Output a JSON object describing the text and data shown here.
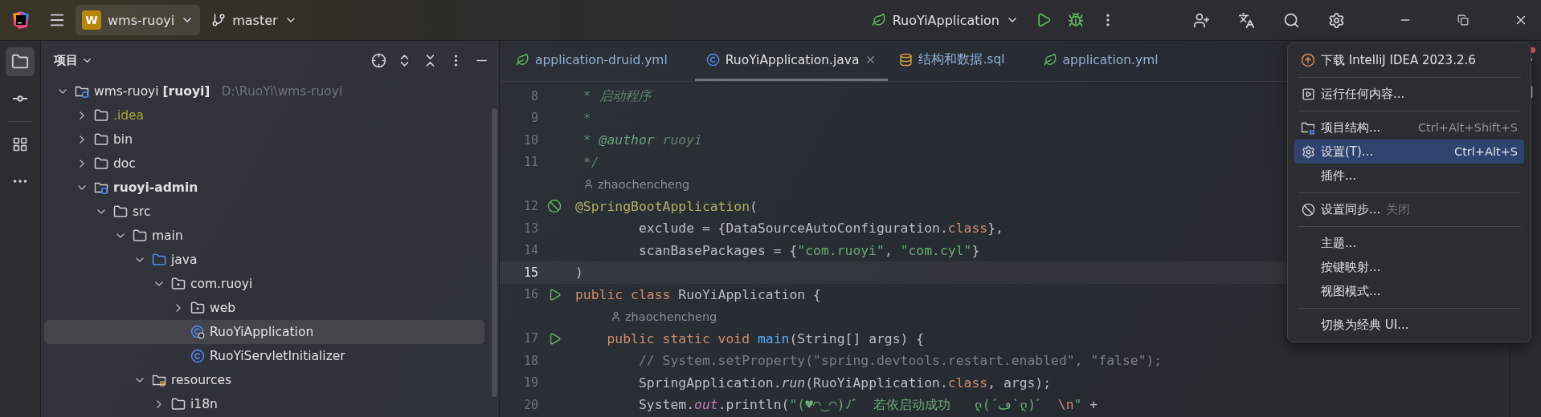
{
  "title_bar": {
    "project": {
      "badge": "W",
      "name": "wms-ruoyi"
    },
    "branch": "master",
    "run_config": "RuoYiApplication"
  },
  "project_panel": {
    "title": "项目",
    "tree": [
      {
        "label": "wms-ruoyi **[ruoyi]**",
        "hint": "D:\\RuoYi\\wms-ruoyi",
        "kind": "module",
        "expanded": true,
        "selected": false,
        "ignored": false,
        "bold": false,
        "children": [
          {
            "label": ".idea",
            "kind": "folder",
            "expanded": false,
            "selected": false,
            "ignored": true,
            "bold": false
          },
          {
            "label": "bin",
            "kind": "folder",
            "expanded": false,
            "selected": false,
            "ignored": false,
            "bold": false
          },
          {
            "label": "doc",
            "kind": "folder",
            "expanded": false,
            "selected": false,
            "ignored": false,
            "bold": false
          },
          {
            "label": "ruoyi-admin",
            "kind": "module",
            "expanded": true,
            "selected": false,
            "ignored": false,
            "bold": true,
            "children": [
              {
                "label": "src",
                "kind": "folder",
                "expanded": true,
                "selected": false,
                "ignored": false,
                "bold": false,
                "children": [
                  {
                    "label": "main",
                    "kind": "folder",
                    "expanded": true,
                    "selected": false,
                    "ignored": false,
                    "bold": false,
                    "children": [
                      {
                        "label": "java",
                        "kind": "source",
                        "expanded": true,
                        "selected": false,
                        "ignored": false,
                        "bold": false,
                        "children": [
                          {
                            "label": "com.ruoyi",
                            "kind": "package",
                            "expanded": true,
                            "selected": false,
                            "ignored": false,
                            "bold": false,
                            "children": [
                              {
                                "label": "web",
                                "kind": "package",
                                "expanded": false,
                                "selected": false,
                                "ignored": false,
                                "bold": false
                              },
                              {
                                "label": "RuoYiApplication",
                                "kind": "run-class",
                                "selected": true,
                                "ignored": false,
                                "bold": false
                              },
                              {
                                "label": "RuoYiServletInitializer",
                                "kind": "class",
                                "selected": false,
                                "ignored": false,
                                "bold": false
                              }
                            ]
                          }
                        ]
                      },
                      {
                        "label": "resources",
                        "kind": "resources",
                        "expanded": true,
                        "selected": false,
                        "ignored": false,
                        "bold": false,
                        "children": [
                          {
                            "label": "i18n",
                            "kind": "folder",
                            "expanded": false,
                            "selected": false,
                            "ignored": false,
                            "bold": false
                          }
                        ]
                      }
                    ]
                  }
                ]
              }
            ]
          }
        ]
      }
    ]
  },
  "editor_tabs": [
    {
      "label": "application-druid.yml",
      "kind": "spring",
      "selected": false
    },
    {
      "label": "RuoYiApplication.java",
      "kind": "java",
      "selected": true
    },
    {
      "label": "结构和数据.sql",
      "kind": "sql",
      "selected": false
    },
    {
      "label": "application.yml",
      "kind": "spring",
      "selected": false
    }
  ],
  "code": [
    {
      "kind": "line",
      "number": "8",
      "current": false,
      "tokens": [
        {
          "kind": "doc",
          "text": " * 启动程序"
        }
      ]
    },
    {
      "kind": "line",
      "number": "9",
      "current": false,
      "tokens": [
        {
          "kind": "doc",
          "text": " *"
        }
      ]
    },
    {
      "kind": "line",
      "number": "10",
      "current": false,
      "tokens": [
        {
          "kind": "doc",
          "text": " * "
        },
        {
          "kind": "doctag",
          "text": "@author"
        },
        {
          "kind": "doc",
          "text": " ruoyi"
        }
      ]
    },
    {
      "kind": "line",
      "number": "11",
      "current": false,
      "tokens": [
        {
          "kind": "doc",
          "text": " */"
        }
      ]
    },
    {
      "kind": "author",
      "text": "zhaochencheng"
    },
    {
      "kind": "bean-line",
      "number": "12",
      "current": false,
      "tokens": [
        {
          "kind": "annotation",
          "text": "@SpringBootApplication"
        },
        {
          "kind": "plain",
          "text": "("
        }
      ]
    },
    {
      "kind": "line",
      "number": "13",
      "current": false,
      "tokens": [
        {
          "kind": "plain",
          "text": "        exclude = {DataSourceAutoConfiguration."
        },
        {
          "kind": "keyword",
          "text": "class"
        },
        {
          "kind": "plain",
          "text": "},"
        }
      ]
    },
    {
      "kind": "line",
      "number": "14",
      "current": false,
      "tokens": [
        {
          "kind": "plain",
          "text": "        scanBasePackages = {"
        },
        {
          "kind": "string",
          "text": "\"com.ruoyi\""
        },
        {
          "kind": "plain",
          "text": ", "
        },
        {
          "kind": "string",
          "text": "\"com.cyl\""
        },
        {
          "kind": "plain",
          "text": "}"
        }
      ]
    },
    {
      "kind": "line",
      "number": "15",
      "current": true,
      "tokens": [
        {
          "kind": "plain",
          "text": ")"
        }
      ]
    },
    {
      "kind": "run-line",
      "number": "16",
      "current": false,
      "tokens": [
        {
          "kind": "keyword",
          "text": "public class "
        },
        {
          "kind": "plain",
          "text": "RuoYiApplication {"
        }
      ]
    },
    {
      "kind": "nested-author",
      "text": "zhaochencheng"
    },
    {
      "kind": "run-line",
      "number": "17",
      "current": false,
      "tokens": [
        {
          "kind": "keyword",
          "text": "    public static void "
        },
        {
          "kind": "method",
          "text": "main"
        },
        {
          "kind": "plain",
          "text": "(String[] args) {"
        }
      ]
    },
    {
      "kind": "line",
      "number": "18",
      "current": false,
      "tokens": [
        {
          "kind": "comment",
          "text": "        // System.setProperty(\"spring.devtools.restart.enabled\", \"false\");"
        }
      ]
    },
    {
      "kind": "line",
      "number": "19",
      "current": false,
      "tokens": [
        {
          "kind": "plain",
          "text": "        SpringApplication."
        },
        {
          "kind": "italic",
          "text": "run"
        },
        {
          "kind": "plain",
          "text": "(RuoYiApplication."
        },
        {
          "kind": "keyword",
          "text": "class"
        },
        {
          "kind": "plain",
          "text": ", args);"
        }
      ]
    },
    {
      "kind": "line",
      "number": "20",
      "current": false,
      "tokens": [
        {
          "kind": "plain",
          "text": "        System."
        },
        {
          "kind": "field",
          "text": "out"
        },
        {
          "kind": "plain",
          "text": ".println("
        },
        {
          "kind": "string",
          "text": "\"(♥◠‿◠)ﾉﾞ  若依启动成功   ლ(´ڡ`ლ)ﾞ  "
        },
        {
          "kind": "escape",
          "text": "\\n"
        },
        {
          "kind": "string",
          "text": "\""
        },
        {
          "kind": "plain",
          "text": " +"
        }
      ]
    }
  ],
  "menu": [
    {
      "kind": "update",
      "label": "下载 IntelliJ IDEA 2023.2.6",
      "selected": false
    },
    {
      "kind": "separator"
    },
    {
      "kind": "run",
      "label": "运行任何内容...",
      "selected": false
    },
    {
      "kind": "separator"
    },
    {
      "kind": "structure",
      "label": "项目结构...",
      "shortcut": "Ctrl+Alt+Shift+S",
      "selected": false
    },
    {
      "kind": "settings",
      "label": "设置(T)...",
      "shortcut": "Ctrl+Alt+S",
      "selected": true
    },
    {
      "kind": "item",
      "label": "插件...",
      "selected": false
    },
    {
      "kind": "separator"
    },
    {
      "kind": "sync",
      "label": "设置同步...",
      "hint": "关闭",
      "selected": false
    },
    {
      "kind": "separator"
    },
    {
      "kind": "item",
      "label": "主题...",
      "selected": false
    },
    {
      "kind": "item",
      "label": "按键映射...",
      "selected": false
    },
    {
      "kind": "item",
      "label": "视图模式...",
      "selected": false
    },
    {
      "kind": "separator"
    },
    {
      "kind": "item",
      "label": "切换为经典 UI...",
      "selected": false
    }
  ]
}
